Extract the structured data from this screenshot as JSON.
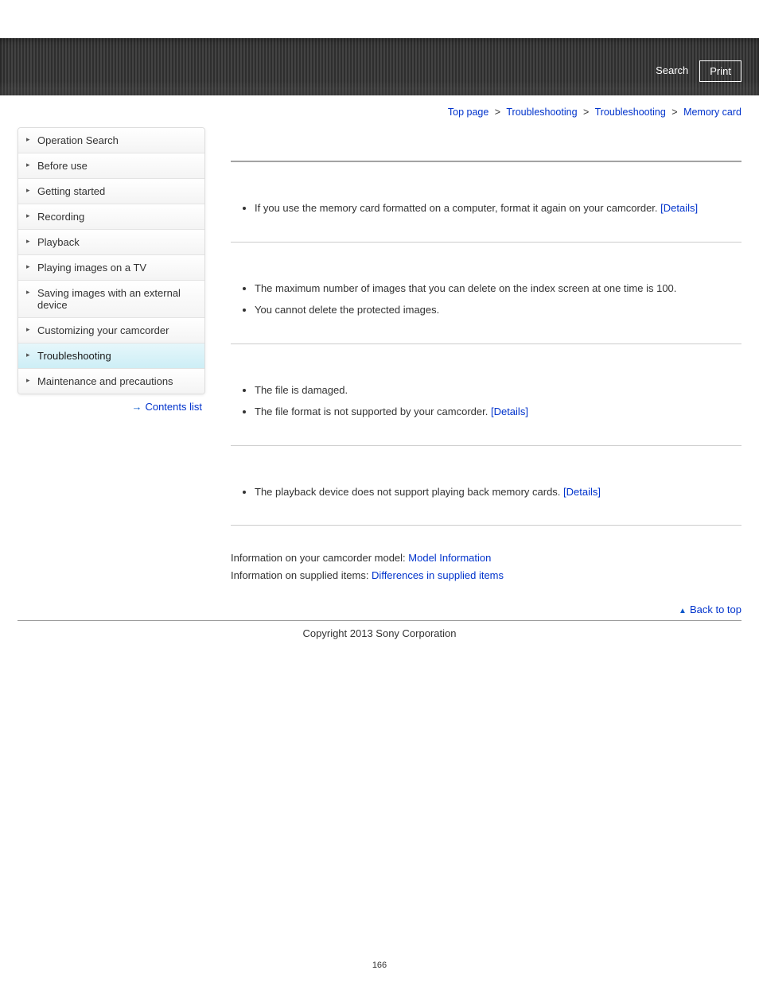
{
  "header": {
    "search_label": "Search",
    "print_label": "Print"
  },
  "breadcrumb": {
    "items": [
      "Top page",
      "Troubleshooting",
      "Troubleshooting",
      "Memory card"
    ],
    "separator": ">"
  },
  "sidebar": {
    "items": [
      {
        "label": "Operation Search",
        "active": false
      },
      {
        "label": "Before use",
        "active": false
      },
      {
        "label": "Getting started",
        "active": false
      },
      {
        "label": "Recording",
        "active": false
      },
      {
        "label": "Playback",
        "active": false
      },
      {
        "label": "Playing images on a TV",
        "active": false
      },
      {
        "label": "Saving images with an external device",
        "active": false
      },
      {
        "label": "Customizing your camcorder",
        "active": false
      },
      {
        "label": "Troubleshooting",
        "active": true
      },
      {
        "label": "Maintenance and precautions",
        "active": false
      }
    ],
    "contents_label": "Contents list"
  },
  "content": {
    "details_link": "[Details]",
    "section1": {
      "li1_text": "If you use the memory card formatted on a computer, format it again on your camcorder. "
    },
    "section2": {
      "li1": "The maximum number of images that you can delete on the index screen at one time is 100.",
      "li2": "You cannot delete the protected images."
    },
    "section3": {
      "li1": "The file is damaged.",
      "li2_text": "The file format is not supported by your camcorder. "
    },
    "section4": {
      "li1_text": "The playback device does not support playing back memory cards. "
    },
    "info": {
      "model_prefix": "Information on your camcorder model: ",
      "model_link": "Model Information",
      "supplied_prefix": "Information on supplied items: ",
      "supplied_link": "Differences in supplied items"
    },
    "back_to_top": "Back to top"
  },
  "footer": {
    "copyright": "Copyright 2013 Sony Corporation",
    "page_number": "166"
  }
}
